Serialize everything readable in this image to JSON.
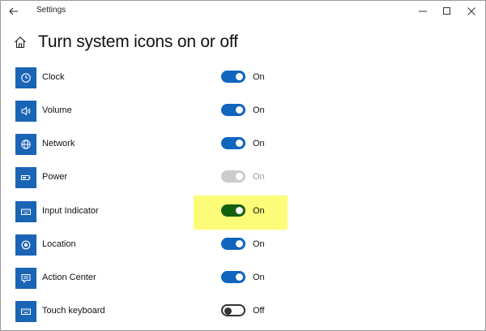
{
  "window": {
    "title": "Settings"
  },
  "page": {
    "title": "Turn system icons on or off"
  },
  "colors": {
    "accent": "#1065bf",
    "tile": "#1a64b6",
    "highlight_toggle": "#13600e",
    "highlight_bg": "#fcfc79",
    "disabled": "#cccccc"
  },
  "items": [
    {
      "label": "Clock",
      "state": "On",
      "icon": "clock-icon",
      "mode": "on"
    },
    {
      "label": "Volume",
      "state": "On",
      "icon": "volume-icon",
      "mode": "on"
    },
    {
      "label": "Network",
      "state": "On",
      "icon": "network-globe-icon",
      "mode": "on"
    },
    {
      "label": "Power",
      "state": "On",
      "icon": "battery-icon",
      "mode": "disabled"
    },
    {
      "label": "Input Indicator",
      "state": "On",
      "icon": "keyboard-icon",
      "mode": "highlighted"
    },
    {
      "label": "Location",
      "state": "On",
      "icon": "location-icon",
      "mode": "on"
    },
    {
      "label": "Action Center",
      "state": "On",
      "icon": "action-center-icon",
      "mode": "on"
    },
    {
      "label": "Touch keyboard",
      "state": "Off",
      "icon": "touch-keyboard-icon",
      "mode": "off"
    }
  ]
}
